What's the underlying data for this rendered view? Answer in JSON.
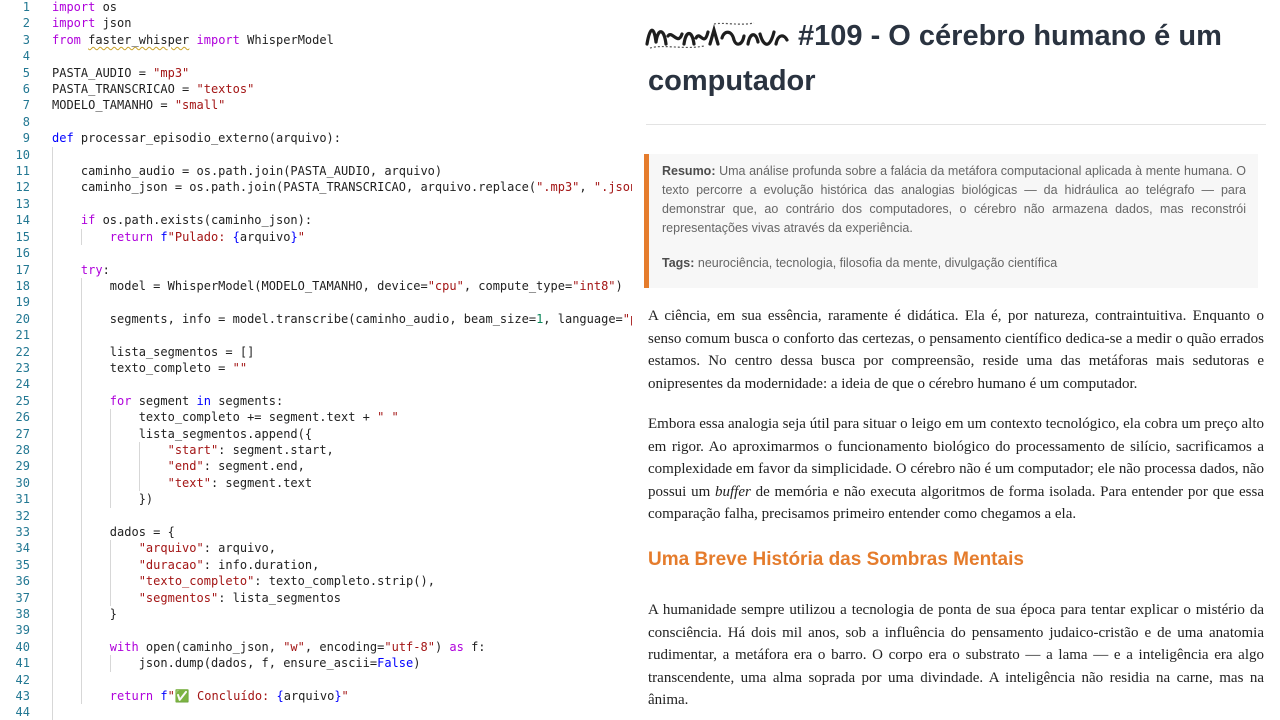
{
  "editor": {
    "lines": [
      {
        "n": "1",
        "indent": 0,
        "parts": [
          [
            "kw2",
            "import"
          ],
          [
            "t",
            " os"
          ]
        ]
      },
      {
        "n": "2",
        "indent": 0,
        "parts": [
          [
            "kw2",
            "import"
          ],
          [
            "t",
            " json"
          ]
        ]
      },
      {
        "n": "3",
        "indent": 0,
        "parts": [
          [
            "kw2",
            "from"
          ],
          [
            "t",
            " "
          ],
          [
            "sq",
            "faster_whisper"
          ],
          [
            "t",
            " "
          ],
          [
            "kw2",
            "import"
          ],
          [
            "t",
            " WhisperModel"
          ]
        ]
      },
      {
        "n": "4",
        "indent": 0,
        "parts": []
      },
      {
        "n": "5",
        "indent": 0,
        "parts": [
          [
            "t",
            "PASTA_AUDIO = "
          ],
          [
            "str",
            "\"mp3\""
          ]
        ]
      },
      {
        "n": "6",
        "indent": 0,
        "parts": [
          [
            "t",
            "PASTA_TRANSCRICAO = "
          ],
          [
            "str",
            "\"textos\""
          ]
        ]
      },
      {
        "n": "7",
        "indent": 0,
        "parts": [
          [
            "t",
            "MODELO_TAMANHO = "
          ],
          [
            "str",
            "\"small\""
          ]
        ]
      },
      {
        "n": "8",
        "indent": 0,
        "parts": []
      },
      {
        "n": "9",
        "indent": 0,
        "parts": [
          [
            "kw",
            "def"
          ],
          [
            "t",
            " processar_episodio_externo(arquivo):"
          ]
        ]
      },
      {
        "n": "10",
        "indent": 1,
        "parts": []
      },
      {
        "n": "11",
        "indent": 1,
        "parts": [
          [
            "t",
            "    caminho_audio = os.path.join(PASTA_AUDIO, arquivo)"
          ]
        ]
      },
      {
        "n": "12",
        "indent": 1,
        "parts": [
          [
            "t",
            "    caminho_json = os.path.join(PASTA_TRANSCRICAO, arquivo.replace("
          ],
          [
            "str",
            "\".mp3\""
          ],
          [
            "t",
            ", "
          ],
          [
            "str",
            "\".json\""
          ],
          [
            "t",
            "))"
          ]
        ]
      },
      {
        "n": "13",
        "indent": 1,
        "parts": []
      },
      {
        "n": "14",
        "indent": 1,
        "parts": [
          [
            "t",
            "    "
          ],
          [
            "kw2",
            "if"
          ],
          [
            "t",
            " os.path.exists(caminho_json):"
          ]
        ]
      },
      {
        "n": "15",
        "indent": 2,
        "parts": [
          [
            "t",
            "        "
          ],
          [
            "kw2",
            "return"
          ],
          [
            "t",
            " "
          ],
          [
            "kw",
            "f"
          ],
          [
            "str",
            "\"Pulado: "
          ],
          [
            "kw",
            "{"
          ],
          [
            "t",
            "arquivo"
          ],
          [
            "kw",
            "}"
          ],
          [
            "str",
            "\""
          ]
        ]
      },
      {
        "n": "16",
        "indent": 1,
        "parts": []
      },
      {
        "n": "17",
        "indent": 1,
        "parts": [
          [
            "t",
            "    "
          ],
          [
            "kw2",
            "try"
          ],
          [
            "t",
            ":"
          ]
        ]
      },
      {
        "n": "18",
        "indent": 2,
        "parts": [
          [
            "t",
            "        model = WhisperModel(MODELO_TAMANHO, device="
          ],
          [
            "str",
            "\"cpu\""
          ],
          [
            "t",
            ", compute_type="
          ],
          [
            "str",
            "\"int8\""
          ],
          [
            "t",
            ")"
          ]
        ]
      },
      {
        "n": "19",
        "indent": 2,
        "parts": []
      },
      {
        "n": "20",
        "indent": 2,
        "parts": [
          [
            "t",
            "        segments, info = model.transcribe(caminho_audio, beam_size="
          ],
          [
            "num",
            "1"
          ],
          [
            "t",
            ", language="
          ],
          [
            "str",
            "\"pt\""
          ],
          [
            "t",
            ")"
          ]
        ]
      },
      {
        "n": "21",
        "indent": 2,
        "parts": []
      },
      {
        "n": "22",
        "indent": 2,
        "parts": [
          [
            "t",
            "        lista_segmentos = []"
          ]
        ]
      },
      {
        "n": "23",
        "indent": 2,
        "parts": [
          [
            "t",
            "        texto_completo = "
          ],
          [
            "str",
            "\"\""
          ]
        ]
      },
      {
        "n": "24",
        "indent": 2,
        "parts": []
      },
      {
        "n": "25",
        "indent": 2,
        "parts": [
          [
            "t",
            "        "
          ],
          [
            "kw2",
            "for"
          ],
          [
            "t",
            " segment "
          ],
          [
            "kw",
            "in"
          ],
          [
            "t",
            " segments:"
          ]
        ]
      },
      {
        "n": "26",
        "indent": 3,
        "parts": [
          [
            "t",
            "            texto_completo += segment.text + "
          ],
          [
            "str",
            "\" \""
          ]
        ]
      },
      {
        "n": "27",
        "indent": 3,
        "parts": [
          [
            "t",
            "            lista_segmentos.append({"
          ]
        ]
      },
      {
        "n": "28",
        "indent": 4,
        "parts": [
          [
            "t",
            "                "
          ],
          [
            "str",
            "\"start\""
          ],
          [
            "t",
            ": segment.start,"
          ]
        ]
      },
      {
        "n": "29",
        "indent": 4,
        "parts": [
          [
            "t",
            "                "
          ],
          [
            "str",
            "\"end\""
          ],
          [
            "t",
            ": segment.end,"
          ]
        ]
      },
      {
        "n": "30",
        "indent": 4,
        "parts": [
          [
            "t",
            "                "
          ],
          [
            "str",
            "\"text\""
          ],
          [
            "t",
            ": segment.text"
          ]
        ]
      },
      {
        "n": "31",
        "indent": 3,
        "parts": [
          [
            "t",
            "            })"
          ]
        ]
      },
      {
        "n": "32",
        "indent": 2,
        "parts": []
      },
      {
        "n": "33",
        "indent": 2,
        "parts": [
          [
            "t",
            "        dados = {"
          ]
        ]
      },
      {
        "n": "34",
        "indent": 3,
        "parts": [
          [
            "t",
            "            "
          ],
          [
            "str",
            "\"arquivo\""
          ],
          [
            "t",
            ": arquivo,"
          ]
        ]
      },
      {
        "n": "35",
        "indent": 3,
        "parts": [
          [
            "t",
            "            "
          ],
          [
            "str",
            "\"duracao\""
          ],
          [
            "t",
            ": info.duration,"
          ]
        ]
      },
      {
        "n": "36",
        "indent": 3,
        "parts": [
          [
            "t",
            "            "
          ],
          [
            "str",
            "\"texto_completo\""
          ],
          [
            "t",
            ": texto_completo.strip(),"
          ]
        ]
      },
      {
        "n": "37",
        "indent": 3,
        "parts": [
          [
            "t",
            "            "
          ],
          [
            "str",
            "\"segmentos\""
          ],
          [
            "t",
            ": lista_segmentos"
          ]
        ]
      },
      {
        "n": "38",
        "indent": 2,
        "parts": [
          [
            "t",
            "        }"
          ]
        ]
      },
      {
        "n": "39",
        "indent": 2,
        "parts": []
      },
      {
        "n": "40",
        "indent": 2,
        "parts": [
          [
            "t",
            "        "
          ],
          [
            "kw2",
            "with"
          ],
          [
            "t",
            " open(caminho_json, "
          ],
          [
            "str",
            "\"w\""
          ],
          [
            "t",
            ", encoding="
          ],
          [
            "str",
            "\"utf-8\""
          ],
          [
            "t",
            ") "
          ],
          [
            "kw2",
            "as"
          ],
          [
            "t",
            " f:"
          ]
        ]
      },
      {
        "n": "41",
        "indent": 3,
        "parts": [
          [
            "t",
            "            json.dump(dados, f, ensure_ascii="
          ],
          [
            "kw",
            "False"
          ],
          [
            "t",
            ")"
          ]
        ]
      },
      {
        "n": "42",
        "indent": 2,
        "parts": []
      },
      {
        "n": "43",
        "indent": 2,
        "parts": [
          [
            "t",
            "        "
          ],
          [
            "kw2",
            "return"
          ],
          [
            "t",
            " "
          ],
          [
            "kw",
            "f"
          ],
          [
            "str",
            "\"✅ Concluído: "
          ],
          [
            "kw",
            "{"
          ],
          [
            "t",
            "arquivo"
          ],
          [
            "kw",
            "}"
          ],
          [
            "str",
            "\""
          ]
        ]
      },
      {
        "n": "44",
        "indent": 1,
        "parts": []
      }
    ]
  },
  "article": {
    "title": "#109 - O cérebro humano é um computador",
    "summary_label": "Resumo:",
    "summary_text": "Uma análise profunda sobre a falácia da metáfora computacional aplicada à mente humana. O texto percorre a evolução histórica das analogias biológicas — da hidráulica ao telégrafo — para demonstrar que, ao contrário dos computadores, o cérebro não armazena dados, mas reconstrói representações vivas através da experiência.",
    "tags_label": "Tags:",
    "tags_text": "neurociência, tecnologia, filosofia da mente, divulgação científica",
    "paragraph_1": "A ciência, em sua essência, raramente é didática. Ela é, por natureza, contraintuitiva. Enquanto o senso comum busca o conforto das certezas, o pensamento científico dedica-se a medir o quão errados estamos. No centro dessa busca por compreensão, reside uma das metáforas mais sedutoras e onipresentes da modernidade: a ideia de que o cérebro humano é um computador.",
    "paragraph_2_before": "Embora essa analogia seja útil para situar o leigo em um contexto tecnológico, ela cobra um preço alto em rigor. Ao aproximarmos o funcionamento biológico do processamento de silício, sacrificamos a complexidade em favor da simplicidade. O cérebro não é um computador; ele não processa dados, não possui um ",
    "paragraph_2_em": "buffer",
    "paragraph_2_after": " de memória e não executa algoritmos de forma isolada. Para entender por que essa comparação falha, precisamos primeiro entender como chegamos a ela.",
    "section_heading": "Uma Breve História das Sombras Mentais",
    "paragraph_3": "A humanidade sempre utilizou a tecnologia de ponta de sua época para tentar explicar o mistério da consciência. Há dois mil anos, sob a influência do pensamento judaico-cristão e de uma anatomia rudimentar, a metáfora era o barro. O corpo era o substrato — a lama — e a inteligência era algo transcendente, uma alma soprada por uma divindade. A inteligência não residia na carne, mas na ânima."
  },
  "colors": {
    "accent": "#e57c2c",
    "title": "#2a3340",
    "keyword_blue": "#0000ff",
    "keyword_purple": "#af00db",
    "string": "#a31515",
    "number": "#098658",
    "line_number": "#237893"
  }
}
